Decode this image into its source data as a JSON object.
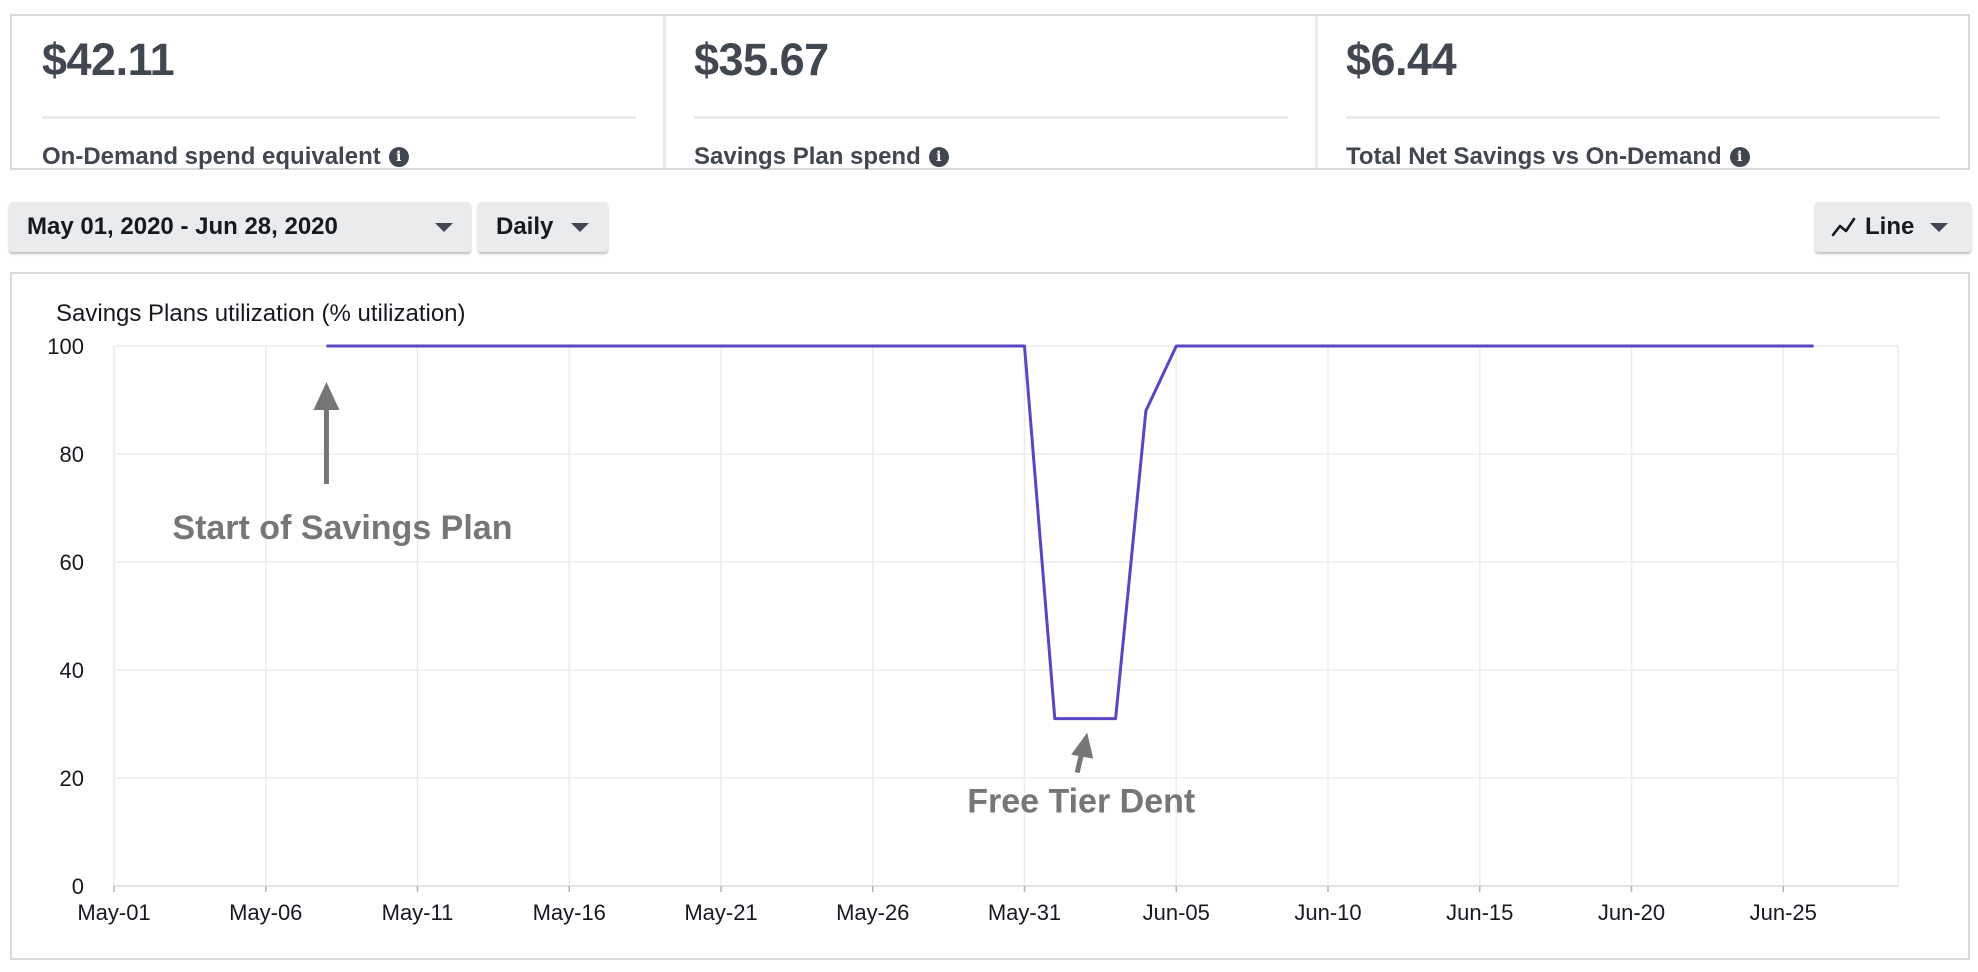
{
  "summary": [
    {
      "value": "$42.11",
      "label": "On-Demand spend equivalent"
    },
    {
      "value": "$35.67",
      "label": "Savings Plan spend"
    },
    {
      "value": "$6.44",
      "label": "Total Net Savings vs On-Demand"
    }
  ],
  "toolbar": {
    "date_range": "May 01, 2020 - Jun 28, 2020",
    "granularity": "Daily",
    "chart_view": "Line"
  },
  "icons": {
    "info": "info-icon",
    "dropdown": "caret-down-icon",
    "line_chart": "line-chart-icon"
  },
  "colors": {
    "series": "#5a45c2",
    "annotation": "#767676"
  },
  "chart_data": {
    "type": "line",
    "title": "Savings Plans utilization (% utilization)",
    "xlabel": "",
    "ylabel": "",
    "ylim": [
      0,
      100
    ],
    "yticks": [
      0,
      20,
      40,
      60,
      80,
      100
    ],
    "xticks": [
      "May-01",
      "May-06",
      "May-11",
      "May-16",
      "May-21",
      "May-26",
      "May-31",
      "Jun-05",
      "Jun-10",
      "Jun-15",
      "Jun-20",
      "Jun-25"
    ],
    "grid": true,
    "series": [
      {
        "x": [
          "2020-05-08",
          "2020-05-31",
          "2020-06-01",
          "2020-06-02",
          "2020-06-03",
          "2020-06-04",
          "2020-06-05",
          "2020-06-26"
        ],
        "values": [
          100,
          100,
          31,
          31,
          31,
          88,
          100,
          100
        ]
      }
    ],
    "annotations": [
      {
        "text": "Start of Savings Plan",
        "x": "2020-05-08",
        "y": 100
      },
      {
        "text": "Free Tier Dent",
        "x": "2020-06-02",
        "y": 31
      }
    ]
  }
}
